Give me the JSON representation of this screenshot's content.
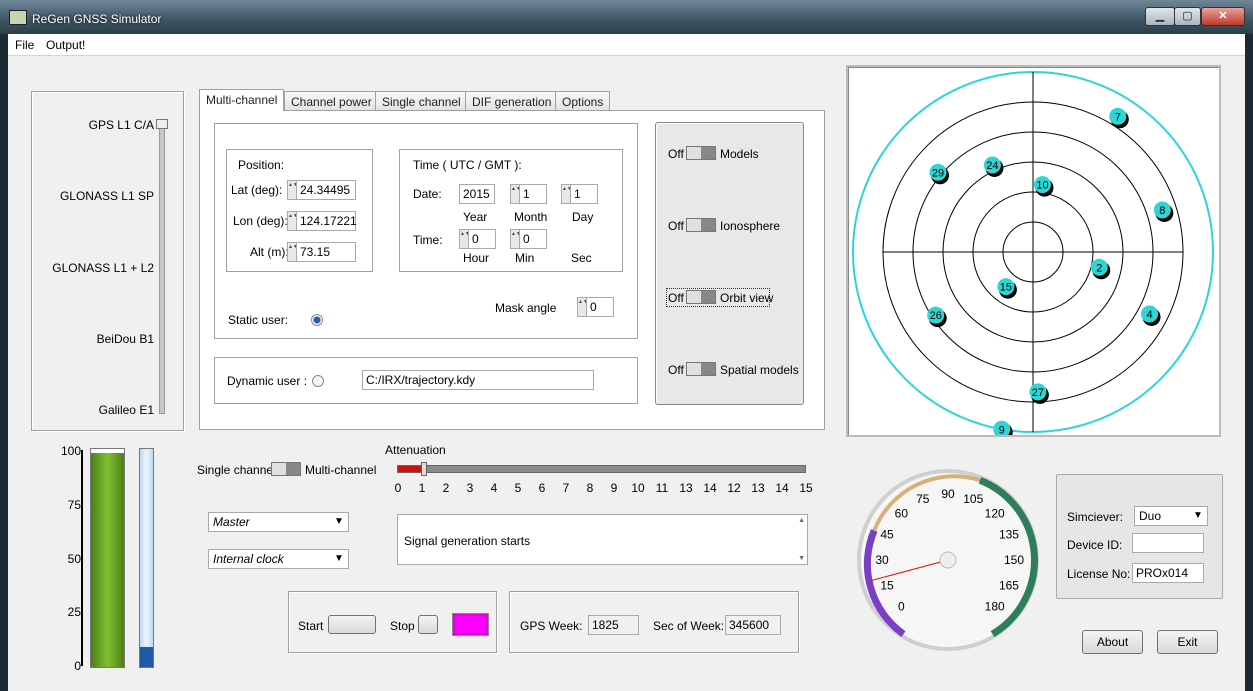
{
  "window": {
    "title": "ReGen GNSS Simulator",
    "min": "▁",
    "max": "▢",
    "close": "✕"
  },
  "menu": [
    "File",
    "Output!"
  ],
  "signals": [
    "GPS L1 C/A",
    "GLONASS L1 SP",
    "GLONASS L1 + L2",
    "BeiDou B1",
    "Galileo E1"
  ],
  "tabs": [
    "Multi-channel",
    "Channel power",
    "Single channel",
    "DIF generation",
    "Options"
  ],
  "position": {
    "title": "Position:",
    "lat_label": "Lat (deg):",
    "lat": "24.34495",
    "lon_label": "Lon (deg):",
    "lon": "124.17221",
    "alt_label": "Alt (m):",
    "alt": "73.15"
  },
  "time": {
    "title": "Time ( UTC / GMT ):",
    "date_label": "Date:",
    "time_label": "Time:",
    "year": "2015",
    "month": "1",
    "day": "1",
    "hour": "0",
    "min": "0",
    "year_label": "Year",
    "month_label": "Month",
    "day_label": "Day",
    "hour_label": "Hour",
    "min_label": "Min",
    "sec_label": "Sec"
  },
  "static_user": "Static user:",
  "mask_angle": {
    "label": "Mask angle",
    "value": "0"
  },
  "dynamic_user": {
    "label": "Dynamic user :",
    "path": "C:/IRX/trajectory.kdy"
  },
  "models": [
    {
      "state": "Off",
      "label": "Models"
    },
    {
      "state": "Off",
      "label": "Ionosphere"
    },
    {
      "state": "Off",
      "label": "Orbit view"
    },
    {
      "state": "Off",
      "label": "Spatial models"
    }
  ],
  "satellites": [
    {
      "prn": "7",
      "az": 32,
      "el": 10
    },
    {
      "prn": "24",
      "az": 335,
      "el": 42
    },
    {
      "prn": "10",
      "az": 8,
      "el": 56
    },
    {
      "prn": "29",
      "az": 310,
      "el": 28
    },
    {
      "prn": "8",
      "az": 72,
      "el": 22
    },
    {
      "prn": "2",
      "az": 103,
      "el": 56
    },
    {
      "prn": "15",
      "az": 218,
      "el": 68
    },
    {
      "prn": "4",
      "az": 118,
      "el": 24
    },
    {
      "prn": "26",
      "az": 237,
      "el": 32
    },
    {
      "prn": "27",
      "az": 178,
      "el": 20
    },
    {
      "prn": "9",
      "az": 190,
      "el": 0
    }
  ],
  "level_scale": [
    "100",
    "75",
    "50",
    "25",
    "0"
  ],
  "mode": {
    "left": "Single channel",
    "right": "Multi-channel"
  },
  "attenuation": {
    "label": "Attenuation",
    "value": 1,
    "max": 15,
    "ticks": [
      "0",
      "1",
      "2",
      "3",
      "4",
      "5",
      "6",
      "7",
      "8",
      "9",
      "10",
      "11",
      "13",
      "14",
      "12",
      "13",
      "14",
      "15"
    ]
  },
  "master_combo": "Master",
  "clock_combo": "Internal clock",
  "log": "Signal generation starts",
  "start_label": "Start",
  "stop_label": "Stop",
  "gps_week": {
    "label": "GPS Week:",
    "value": "1825"
  },
  "sec_of_week": {
    "label": "Sec of Week:",
    "value": "345600"
  },
  "gauge": {
    "labels": [
      "0",
      "15",
      "30",
      "45",
      "60",
      "75",
      "90",
      "105",
      "120",
      "135",
      "150",
      "165",
      "180"
    ],
    "value": 20
  },
  "device": {
    "simciever_label": "Simciever:",
    "simciever": "Duo",
    "device_id_label": "Device ID:",
    "device_id": "",
    "license_label": "License No:",
    "license": "PROx014"
  },
  "about": "About",
  "exit": "Exit",
  "colors": {
    "level_green": "#5f9b1e",
    "level_blue": "#4a90d9",
    "sat": "#2fd5d5",
    "active": "#ff00ff",
    "att_red": "#cc1111"
  },
  "levels": {
    "power": 0.98,
    "blue": 0.09
  }
}
